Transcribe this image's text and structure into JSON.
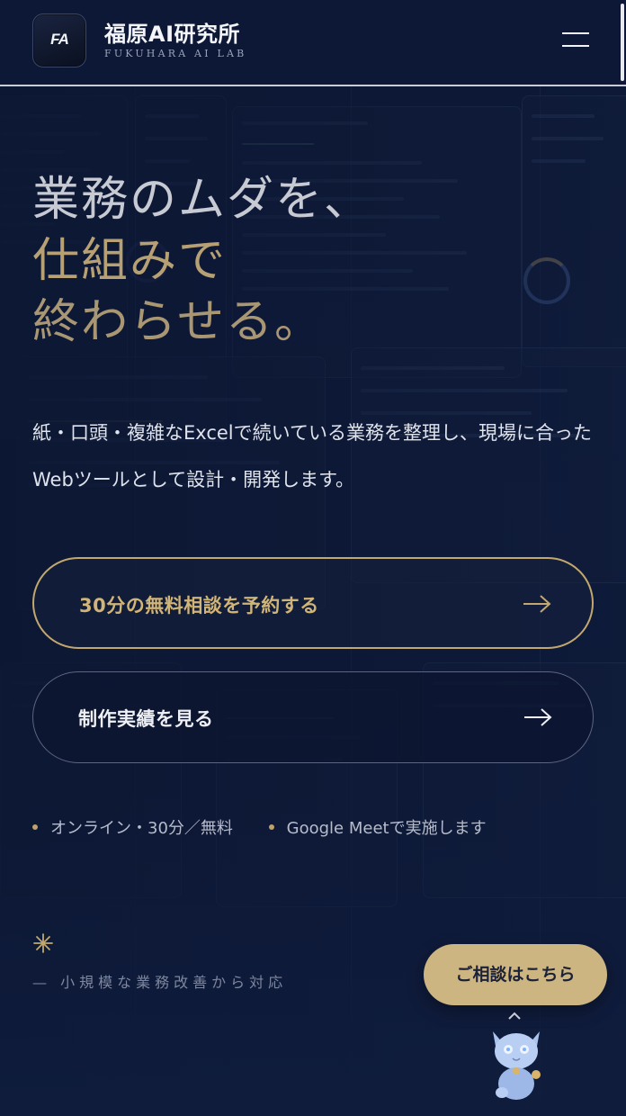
{
  "header": {
    "logo_mark": "FA",
    "brand_name": "福原AI研究所",
    "brand_sub": "FUKUHARA AI LAB",
    "menu_icon": "hamburger-menu-icon"
  },
  "hero": {
    "title_line1": "業務のムダを、",
    "title_line2": "仕組みで",
    "title_line3": "終わらせる。",
    "lead": "紙・口頭・複雑なExcelで続いている業務を整理し、現場に合ったWebツールとして設計・開発します。",
    "primary_cta": "30分の無料相談を予約する",
    "secondary_cta": "制作実績を見る",
    "notes": [
      "オンライン・30分／無料",
      "Google Meetで実施します"
    ],
    "tagline": "— 小規模な業務改善から対応"
  },
  "floating": {
    "consult_button": "ご相談はこちら",
    "mascot_icon": "cat-mascot-icon"
  },
  "colors": {
    "background": "#0c1733",
    "gold": "#c2a86f",
    "consult_bg": "#cdb582"
  }
}
